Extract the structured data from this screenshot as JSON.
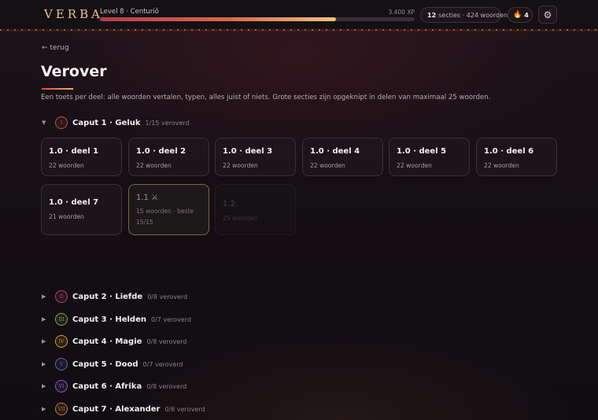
{
  "header": {
    "logo": "VERBA",
    "level_label": "Level 8 · Centuriō",
    "xp_label": "3.400 XP",
    "xp_progress": 0.75,
    "stats": {
      "sections_count": "12",
      "sections_rest": "secties · 424 woorden"
    },
    "streak": "4",
    "flame_icon": "🔥",
    "settings_icon": "⚙"
  },
  "page": {
    "back_link": "← terug",
    "title": "Verover",
    "description": "Een toets per deel: alle woorden vertalen, typen, alles juist of niets. Grote secties zijn opgeknipt in delen van maximaal 25 woorden."
  },
  "caputs": [
    {
      "chevron": "▼",
      "roman": "I",
      "name": "Caput 1 · Geluk",
      "progress": "1/15 veroverd",
      "color": "#c24a4a"
    },
    {
      "chevron": "▶",
      "roman": "II",
      "name": "Caput 2 · Liefde",
      "progress": "0/8 veroverd",
      "color": "#b8446a"
    },
    {
      "chevron": "▶",
      "roman": "III",
      "name": "Caput 3 · Helden",
      "progress": "0/7 veroverd",
      "color": "#7fa84a"
    },
    {
      "chevron": "▶",
      "roman": "IV",
      "name": "Caput 4 · Magie",
      "progress": "0/8 veroverd",
      "color": "#d09a3a"
    },
    {
      "chevron": "▶",
      "roman": "V",
      "name": "Caput 5 · Dood",
      "progress": "0/7 veroverd",
      "color": "#5a6ab0"
    },
    {
      "chevron": "▶",
      "roman": "VI",
      "name": "Caput 6 · Afrika",
      "progress": "0/8 veroverd",
      "color": "#8a5ab8"
    },
    {
      "chevron": "▶",
      "roman": "VII",
      "name": "Caput 7 · Alexander",
      "progress": "0/6 veroverd",
      "color": "#c07a3a"
    }
  ],
  "cards": [
    {
      "title": "1.0 · deel 1",
      "sub": "22 woorden"
    },
    {
      "title": "1.0 · deel 2",
      "sub": "22 woorden"
    },
    {
      "title": "1.0 · deel 3",
      "sub": "22 woorden"
    },
    {
      "title": "1.0 · deel 4",
      "sub": "22 woorden"
    },
    {
      "title": "1.0 · deel 5",
      "sub": "22 woorden"
    },
    {
      "title": "1.0 · deel 6",
      "sub": "22 woorden"
    },
    {
      "title": "1.0 · deel 7",
      "sub": "21 woorden"
    },
    {
      "title": "1.1 ⚔",
      "sub": "15 woorden · beste",
      "best": "15/15"
    },
    {
      "title": "1.2",
      "sub": "25 woorden"
    }
  ]
}
